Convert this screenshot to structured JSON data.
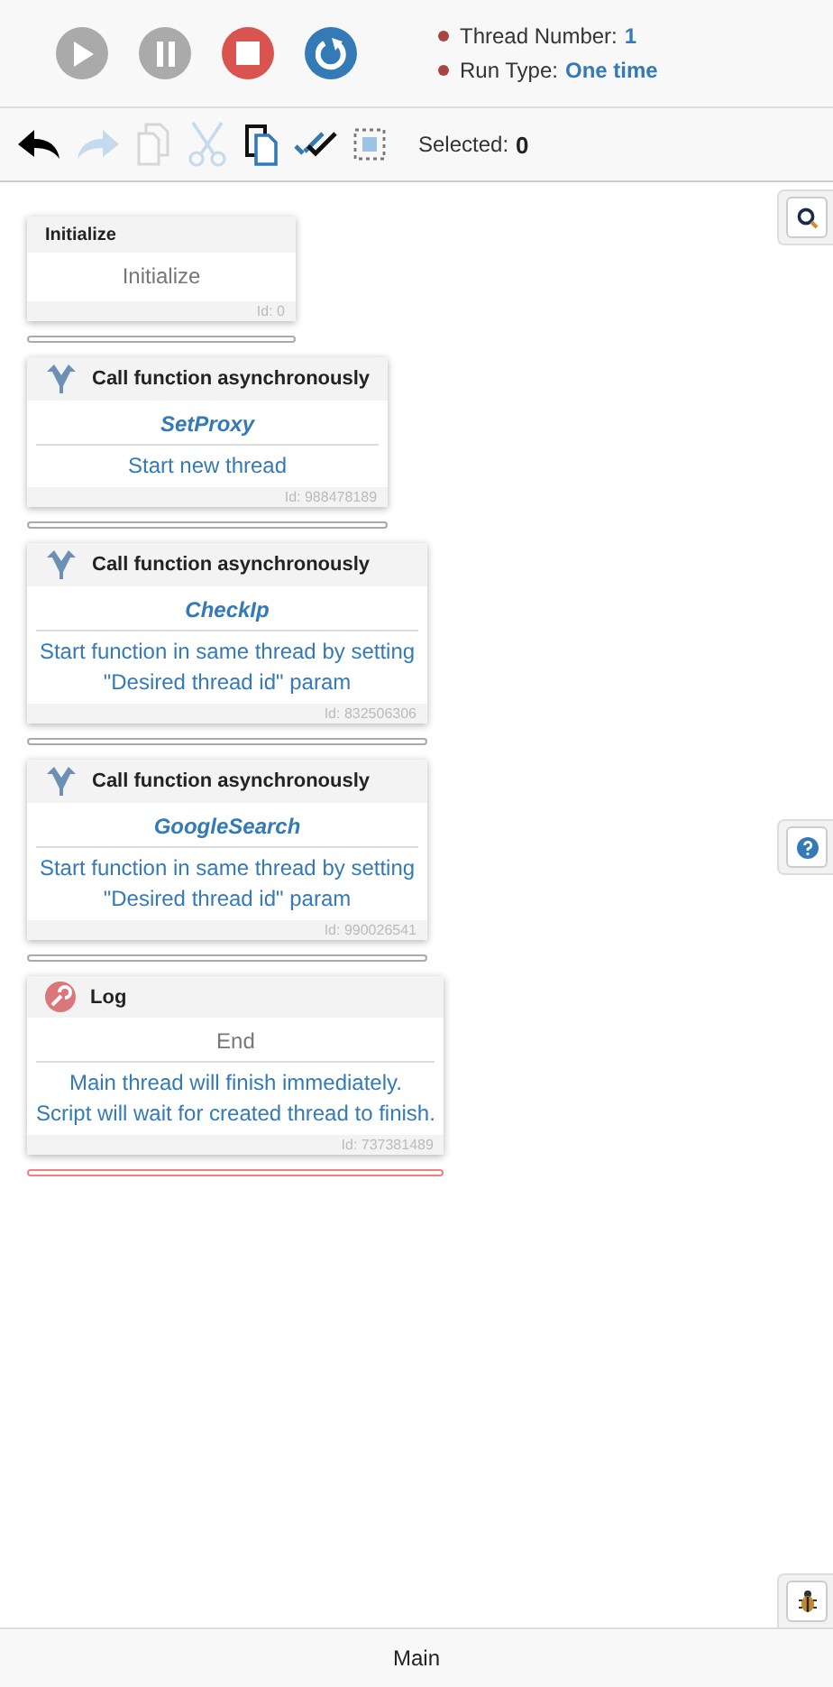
{
  "player": {
    "buttons": [
      {
        "kind": "play",
        "disabled": true
      },
      {
        "kind": "pause",
        "disabled": true
      },
      {
        "kind": "stop",
        "disabled": false
      },
      {
        "kind": "restart",
        "disabled": false
      }
    ],
    "info": [
      {
        "label": "Thread Number:",
        "value": "1"
      },
      {
        "label": "Run Type:",
        "value": "One time"
      }
    ]
  },
  "toolbar": {
    "tools": [
      {
        "kind": "undo",
        "disabled": false
      },
      {
        "kind": "redo",
        "disabled": true
      },
      {
        "kind": "copy",
        "disabled": true
      },
      {
        "kind": "cut",
        "disabled": true
      },
      {
        "kind": "paste",
        "disabled": false
      },
      {
        "kind": "select-all",
        "disabled": false
      },
      {
        "kind": "select-area",
        "disabled": false
      }
    ],
    "selected_label": "Selected:",
    "selected_count": "0"
  },
  "blocks": [
    {
      "kind": "initialize",
      "header": "Initialize",
      "title": "Initialize",
      "id": "Id: 0",
      "drop_zone_highlighted": false
    },
    {
      "kind": "async",
      "header": "Call function asynchronously",
      "title": "SetProxy",
      "description": "Start new thread",
      "id": "Id: 988478189",
      "drop_zone_highlighted": false
    },
    {
      "kind": "async",
      "header": "Call function asynchronously",
      "title": "CheckIp",
      "description": "Start function in same thread by setting \"Desired thread id\" param",
      "id": "Id: 832506306",
      "drop_zone_highlighted": false
    },
    {
      "kind": "async",
      "header": "Call function asynchronously",
      "title": "GoogleSearch",
      "description": "Start function in same thread by setting \"Desired thread id\" param",
      "id": "Id: 990026541",
      "drop_zone_highlighted": false
    },
    {
      "kind": "log",
      "header": "Log",
      "title": "End",
      "description": "Main thread will finish immediately.\nScript will wait for created thread to finish.",
      "id": "Id: 737381489",
      "drop_zone_highlighted": true
    }
  ],
  "side_buttons": [
    {
      "kind": "search"
    },
    {
      "kind": "help"
    },
    {
      "kind": "debug"
    }
  ],
  "footer": {
    "tab": "Main"
  }
}
